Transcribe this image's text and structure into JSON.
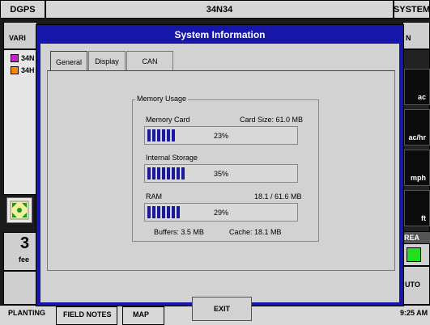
{
  "topbar": {
    "left": "DGPS",
    "center": "34N34",
    "right": "SYSTEM"
  },
  "bg": {
    "var_label": "VARI",
    "n_label": "N",
    "legend": [
      {
        "label": "34N",
        "color": "#cc22cc"
      },
      {
        "label": "34H",
        "color": "#ff8800"
      }
    ],
    "right_units": [
      "ac",
      "ac/hr",
      "mph",
      "ft"
    ],
    "area_label": "REA",
    "area_color": "#22dd22",
    "auto_label": "UTO",
    "fee_label": "fee",
    "big_digit": "3"
  },
  "bottom": {
    "tabs": [
      "PLANTING",
      "FIELD NOTES",
      "MAP"
    ],
    "time": "9:25 AM"
  },
  "dialog": {
    "title": "System Information",
    "tabs": [
      "General",
      "Display",
      "CAN"
    ],
    "memory": {
      "legend": "Memory Usage",
      "card_label": "Memory Card",
      "card_size": "Card Size: 61.0 MB",
      "card_pct": "23%",
      "card_fill": 0.23,
      "internal_label": "Internal Storage",
      "internal_pct": "35%",
      "internal_fill": 0.35,
      "ram_label": "RAM",
      "ram_value": "18.1 / 61.6 MB",
      "ram_pct": "29%",
      "ram_fill": 0.29,
      "buffers": "Buffers: 3.5 MB",
      "cache": "Cache: 18.1 MB"
    },
    "exit_label": "EXIT"
  }
}
